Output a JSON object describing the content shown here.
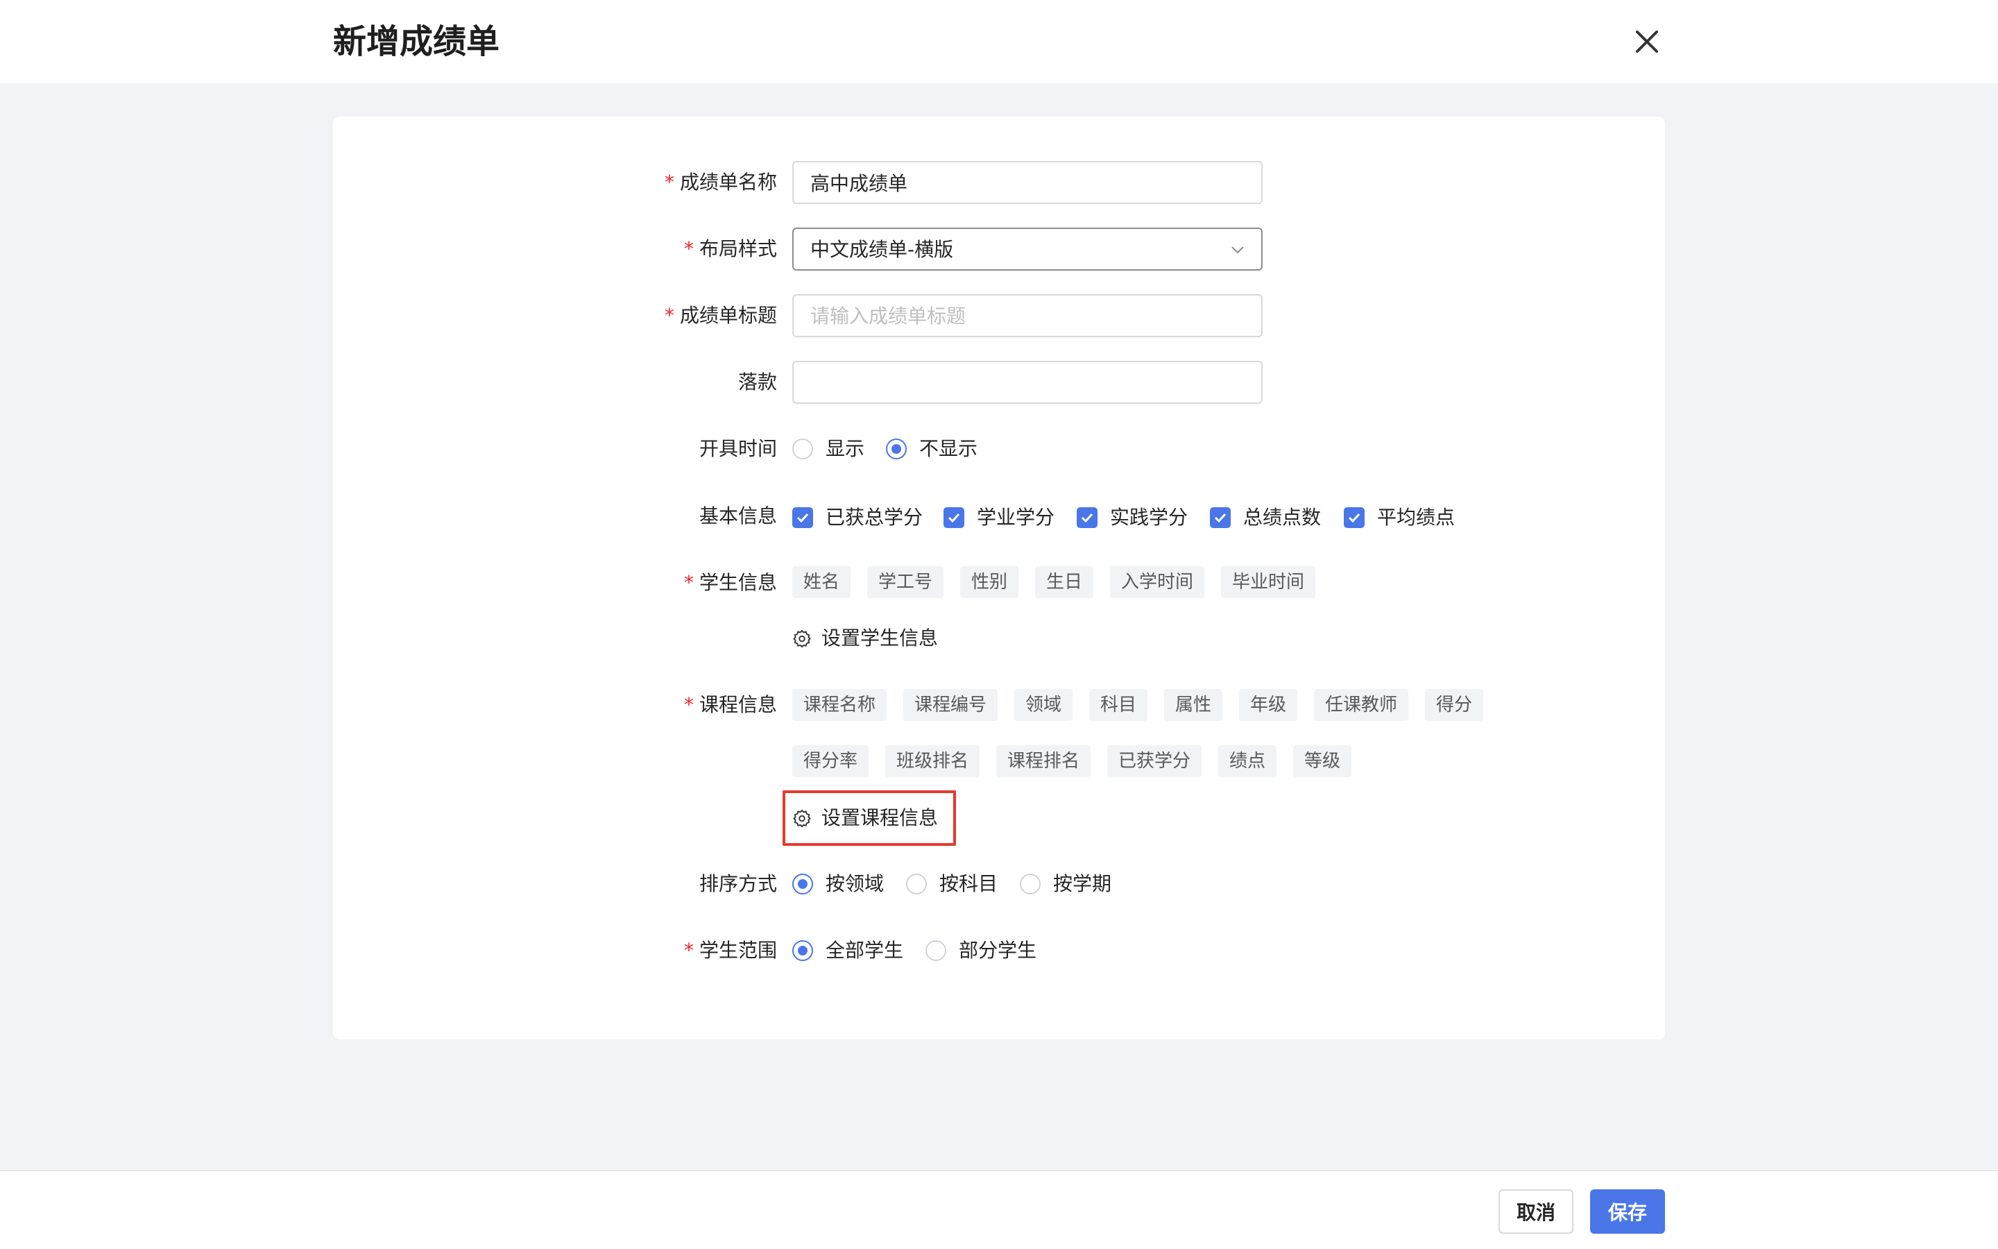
{
  "header": {
    "title": "新增成绩单"
  },
  "form": {
    "name": {
      "label": "成绩单名称",
      "required": true,
      "value": "高中成绩单"
    },
    "layout": {
      "label": "布局样式",
      "required": true,
      "value": "中文成绩单-横版"
    },
    "title": {
      "label": "成绩单标题",
      "required": true,
      "placeholder": "请输入成绩单标题",
      "value": ""
    },
    "signature": {
      "label": "落款",
      "required": false,
      "value": ""
    },
    "issue_time": {
      "label": "开具时间",
      "options": [
        "显示",
        "不显示"
      ],
      "selected": "不显示"
    },
    "basic_info": {
      "label": "基本信息",
      "options": [
        "已获总学分",
        "学业学分",
        "实践学分",
        "总绩点数",
        "平均绩点"
      ],
      "checked": [
        true,
        true,
        true,
        true,
        true
      ]
    },
    "student_info": {
      "label": "学生信息",
      "required": true,
      "tags": [
        "姓名",
        "学工号",
        "性别",
        "生日",
        "入学时间",
        "毕业时间"
      ],
      "set_label": "设置学生信息"
    },
    "course_info": {
      "label": "课程信息",
      "required": true,
      "tags": [
        "课程名称",
        "课程编号",
        "领域",
        "科目",
        "属性",
        "年级",
        "任课教师",
        "得分",
        "得分率",
        "班级排名",
        "课程排名",
        "已获学分",
        "绩点",
        "等级"
      ],
      "set_label": "设置课程信息"
    },
    "sort": {
      "label": "排序方式",
      "options": [
        "按领域",
        "按科目",
        "按学期"
      ],
      "selected": "按领域"
    },
    "scope": {
      "label": "学生范围",
      "required": true,
      "options": [
        "全部学生",
        "部分学生"
      ],
      "selected": "全部学生"
    }
  },
  "footer": {
    "cancel_label": "取消",
    "save_label": "保存"
  },
  "colors": {
    "primary": "#4a76e8",
    "required": "#f5222d",
    "highlight": "#e53a2e",
    "background": "#f2f3f6"
  }
}
